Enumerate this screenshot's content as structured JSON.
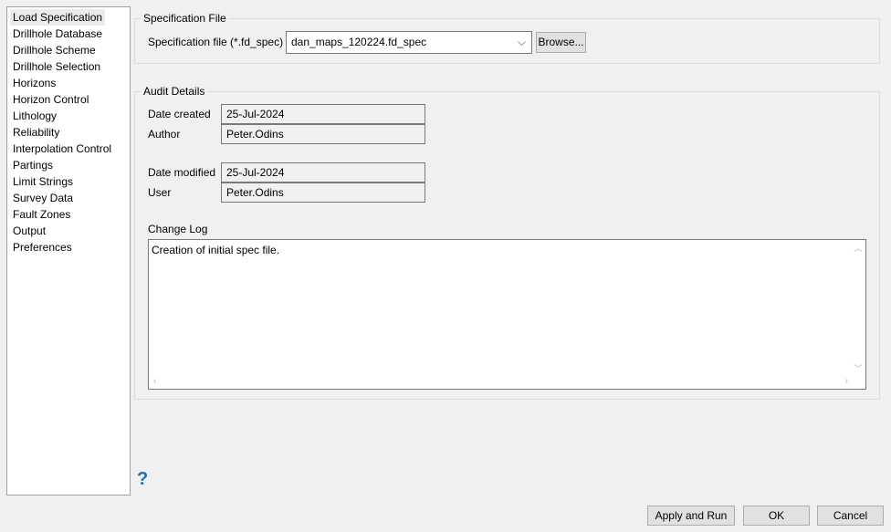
{
  "nav": [
    "Load Specification",
    "Drillhole Database",
    "Drillhole Scheme",
    "Drillhole Selection",
    "Horizons",
    "Horizon Control",
    "Lithology",
    "Reliability",
    "Interpolation Control",
    "Partings",
    "Limit Strings",
    "Survey Data",
    "Fault Zones",
    "Output",
    "Preferences"
  ],
  "spec": {
    "title": "Specification File",
    "label": "Specification file (*.fd_spec)",
    "value": "dan_maps_120224.fd_spec",
    "browse": "Browse..."
  },
  "audit": {
    "title": "Audit Details",
    "date_created_label": "Date created",
    "date_created": "25-Jul-2024",
    "author_label": "Author",
    "author": "Peter.Odins",
    "date_modified_label": "Date modified",
    "date_modified": "25-Jul-2024",
    "user_label": "User",
    "user": "Peter.Odins",
    "changelog_label": "Change Log",
    "changelog": "Creation of initial spec file."
  },
  "buttons": {
    "apply": "Apply and Run",
    "ok": "OK",
    "cancel": "Cancel"
  },
  "help": "?"
}
